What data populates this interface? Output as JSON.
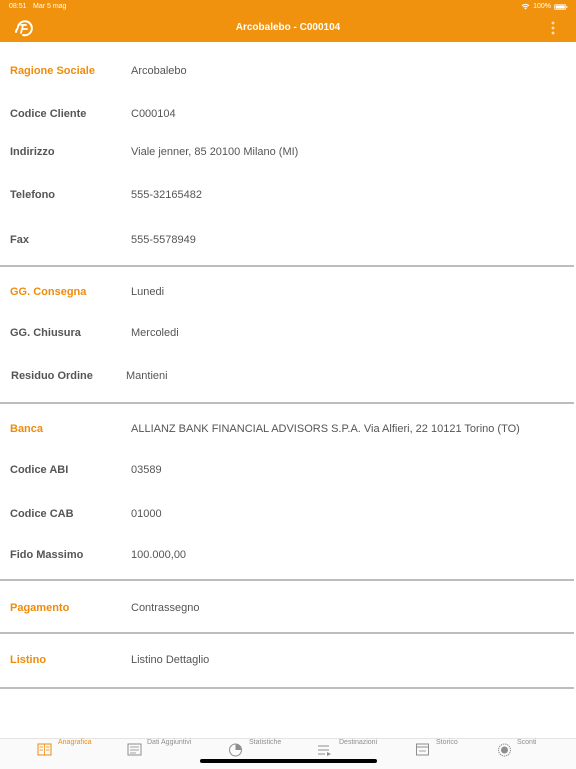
{
  "status_bar": {
    "time": "08:51",
    "date": "Mar 5 mag",
    "battery": "100%",
    "icons": [
      "wifi-icon",
      "battery-icon"
    ]
  },
  "header": {
    "title": "Arcobalebo - C000104",
    "logo_icon": "app-logo-icon",
    "menu_icon": "more-vertical-icon"
  },
  "colors": {
    "accent": "#f0920e",
    "label": "#555555",
    "divider": "#bdbdbd"
  },
  "anagrafica": {
    "ragione_sociale": {
      "label": "Ragione Sociale",
      "value": "Arcobalebo"
    },
    "codice_cliente": {
      "label": "Codice Cliente",
      "value": "C000104"
    },
    "indirizzo": {
      "label": "Indirizzo",
      "value": "Viale jenner, 85 20100 Milano (MI)"
    },
    "telefono": {
      "label": "Telefono",
      "value": "555-32165482"
    },
    "fax": {
      "label": "Fax",
      "value": "555-5578949"
    }
  },
  "consegna": {
    "gg_consegna": {
      "label": "GG. Consegna",
      "value": "Lunedi"
    },
    "gg_chiusura": {
      "label": "GG. Chiusura",
      "value": "Mercoledi"
    },
    "residuo_ordine": {
      "label": "Residuo Ordine",
      "value": "Mantieni"
    }
  },
  "banca": {
    "banca": {
      "label": "Banca",
      "value": "ALLIANZ BANK FINANCIAL ADVISORS S.P.A. Via Alfieri, 22 10121 Torino (TO)"
    },
    "codice_abi": {
      "label": "Codice ABI",
      "value": "03589"
    },
    "codice_cab": {
      "label": "Codice CAB",
      "value": "01000"
    },
    "fido_massimo": {
      "label": "Fido Massimo",
      "value": "100.000,00"
    }
  },
  "pagamento": {
    "label": "Pagamento",
    "value": "Contrassegno"
  },
  "listino": {
    "label": "Listino",
    "value": "Listino Dettaglio"
  },
  "tabs": [
    {
      "label": "Anagrafica",
      "icon": "anagrafica-icon",
      "active": true
    },
    {
      "label": "Dati Aggiuntivi",
      "icon": "dati-aggiuntivi-icon",
      "active": false
    },
    {
      "label": "Statistiche",
      "icon": "pie-chart-icon",
      "active": false
    },
    {
      "label": "Destinazioni",
      "icon": "destinazioni-icon",
      "active": false
    },
    {
      "label": "Storico",
      "icon": "storico-icon",
      "active": false
    },
    {
      "label": "Sconti",
      "icon": "sconti-icon",
      "active": false
    }
  ]
}
